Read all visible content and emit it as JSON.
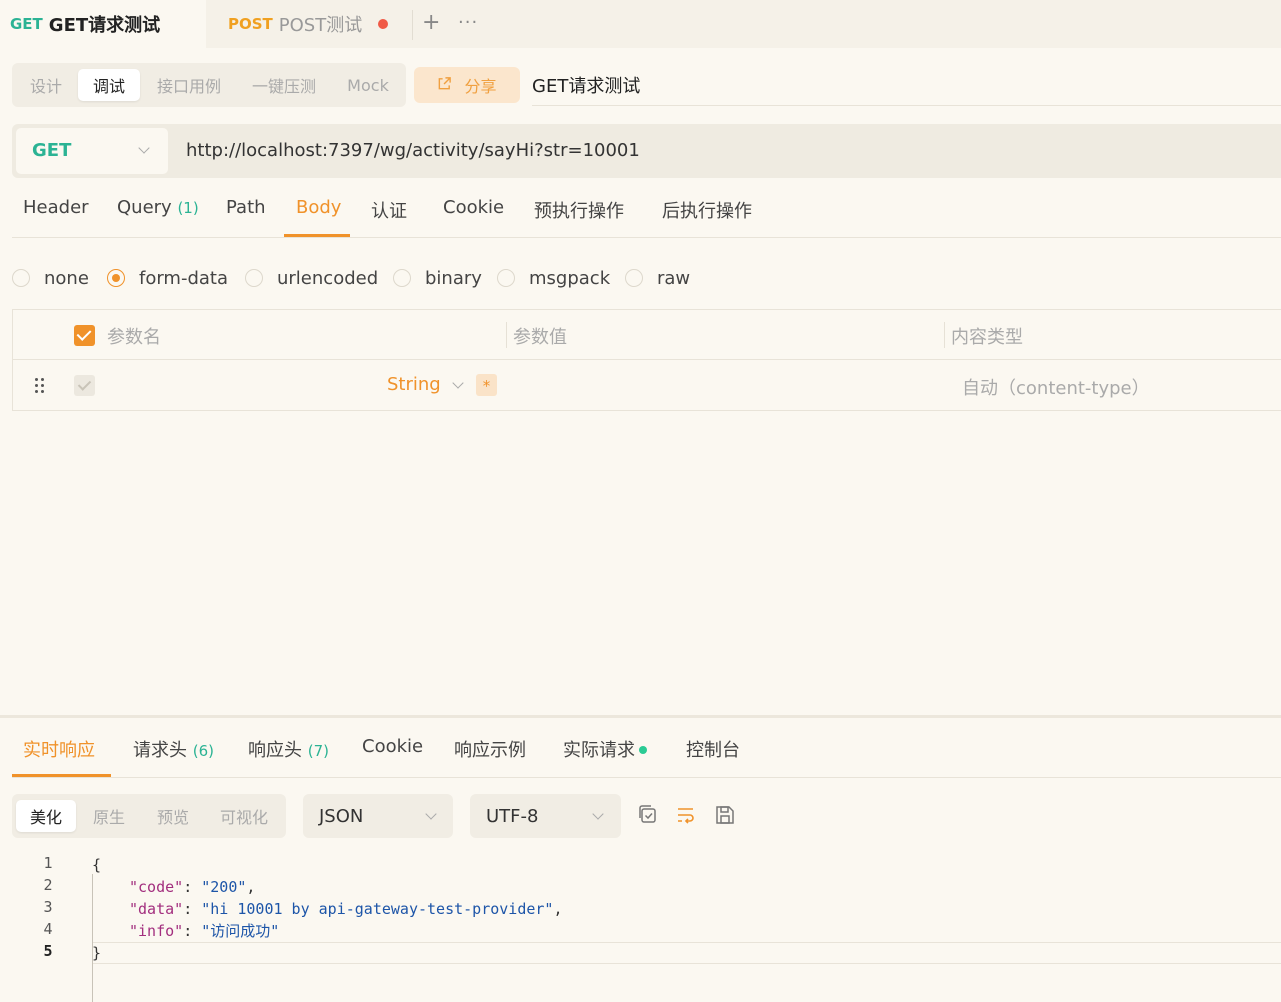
{
  "tabs": [
    {
      "method": "GET",
      "name": "GET请求测试"
    },
    {
      "method": "POST",
      "name": "POST测试"
    }
  ],
  "tab_actions": {
    "add": "+",
    "more": "···"
  },
  "modes": [
    "设计",
    "调试",
    "接口用例",
    "一键压测",
    "Mock"
  ],
  "share_label": "分享",
  "api_name": "GET请求测试",
  "request": {
    "method": "GET",
    "url": "http://localhost:7397/wg/activity/sayHi?str=10001"
  },
  "request_tabs": [
    {
      "label": "Header",
      "count": ""
    },
    {
      "label": "Query",
      "count": "(1)"
    },
    {
      "label": "Path",
      "count": ""
    },
    {
      "label": "Body",
      "count": ""
    },
    {
      "label": "认证",
      "count": ""
    },
    {
      "label": "Cookie",
      "count": ""
    },
    {
      "label": "预执行操作",
      "count": ""
    },
    {
      "label": "后执行操作",
      "count": ""
    }
  ],
  "body_types": [
    "none",
    "form-data",
    "urlencoded",
    "binary",
    "msgpack",
    "raw"
  ],
  "params_table": {
    "headers": [
      "参数名",
      "参数值",
      "内容类型"
    ],
    "row": {
      "type": "String",
      "required": "*",
      "content_type": "自动（content-type）"
    }
  },
  "response_tabs": [
    {
      "label": "实时响应",
      "count": ""
    },
    {
      "label": "请求头",
      "count": "(6)"
    },
    {
      "label": "响应头",
      "count": "(7)"
    },
    {
      "label": "Cookie",
      "count": ""
    },
    {
      "label": "响应示例",
      "count": ""
    },
    {
      "label": "实际请求",
      "count": ""
    },
    {
      "label": "控制台",
      "count": ""
    }
  ],
  "view_modes": [
    "美化",
    "原生",
    "预览",
    "可视化"
  ],
  "format": "JSON",
  "encoding": "UTF-8",
  "response_body": {
    "line_numbers": [
      "1",
      "2",
      "3",
      "4",
      "5"
    ],
    "open_brace": "{",
    "close_brace": "}",
    "fields": [
      {
        "key": "\"code\"",
        "value": "\"200\"",
        "comma": ","
      },
      {
        "key": "\"data\"",
        "value": "\"hi 10001 by api-gateway-test-provider\"",
        "comma": ","
      },
      {
        "key": "\"info\"",
        "value": "\"访问成功\"",
        "comma": ""
      }
    ]
  },
  "colors": {
    "accent": "#f0922a",
    "get_method": "#2bb394",
    "post_method": "#f0a020",
    "unsaved_dot": "#f05a46",
    "background": "#fbf8f1"
  }
}
